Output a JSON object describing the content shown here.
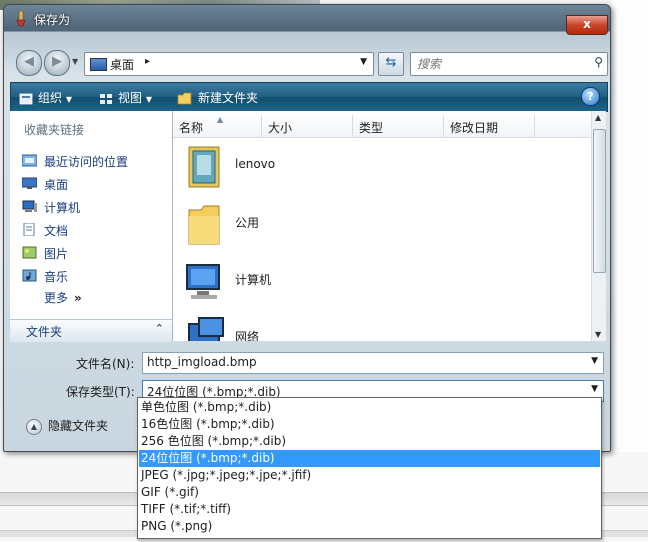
{
  "window": {
    "title": "保存为",
    "close_label": "x"
  },
  "address": {
    "location": "桌面",
    "separator": "▸"
  },
  "search": {
    "placeholder": "搜索"
  },
  "toolbar": {
    "organize": "组织",
    "views": "视图",
    "new_folder": "新建文件夹",
    "help": "?"
  },
  "sidebar": {
    "favorites_title": "收藏夹链接",
    "items": [
      {
        "label": "最近访问的位置",
        "icon": "recent-places-icon"
      },
      {
        "label": "桌面",
        "icon": "desktop-icon"
      },
      {
        "label": "计算机",
        "icon": "computer-icon"
      },
      {
        "label": "文档",
        "icon": "documents-icon"
      },
      {
        "label": "图片",
        "icon": "pictures-icon"
      },
      {
        "label": "音乐",
        "icon": "music-icon"
      }
    ],
    "more": "更多",
    "more_chevron": "»",
    "folders_label": "文件夹",
    "folders_chevron": "⌃"
  },
  "columns": [
    "名称",
    "大小",
    "类型",
    "修改日期"
  ],
  "files": [
    {
      "name": "lenovo",
      "icon": "user-folder-icon"
    },
    {
      "name": "公用",
      "icon": "folder-icon"
    },
    {
      "name": "计算机",
      "icon": "computer-icon"
    },
    {
      "name": "网络",
      "icon": "network-icon"
    }
  ],
  "form": {
    "filename_label": "文件名(N):",
    "filename_value": "http_imgload.bmp",
    "filetype_label": "保存类型(T):",
    "filetype_value": "24位位图 (*.bmp;*.dib)",
    "hide_folders": "隐藏文件夹"
  },
  "filetype_options": [
    "单色位图 (*.bmp;*.dib)",
    "16色位图 (*.bmp;*.dib)",
    "256 色位图 (*.bmp;*.dib)",
    "24位位图 (*.bmp;*.dib)",
    "JPEG (*.jpg;*.jpeg;*.jpe;*.jfif)",
    "GIF (*.gif)",
    "TIFF (*.tif;*.tiff)",
    "PNG (*.png)"
  ],
  "selected_option_index": 3,
  "colors": {
    "toolbar": "#1f5f83",
    "selection": "#3399ff",
    "link": "#1a3e80",
    "close": "#c8452a"
  }
}
